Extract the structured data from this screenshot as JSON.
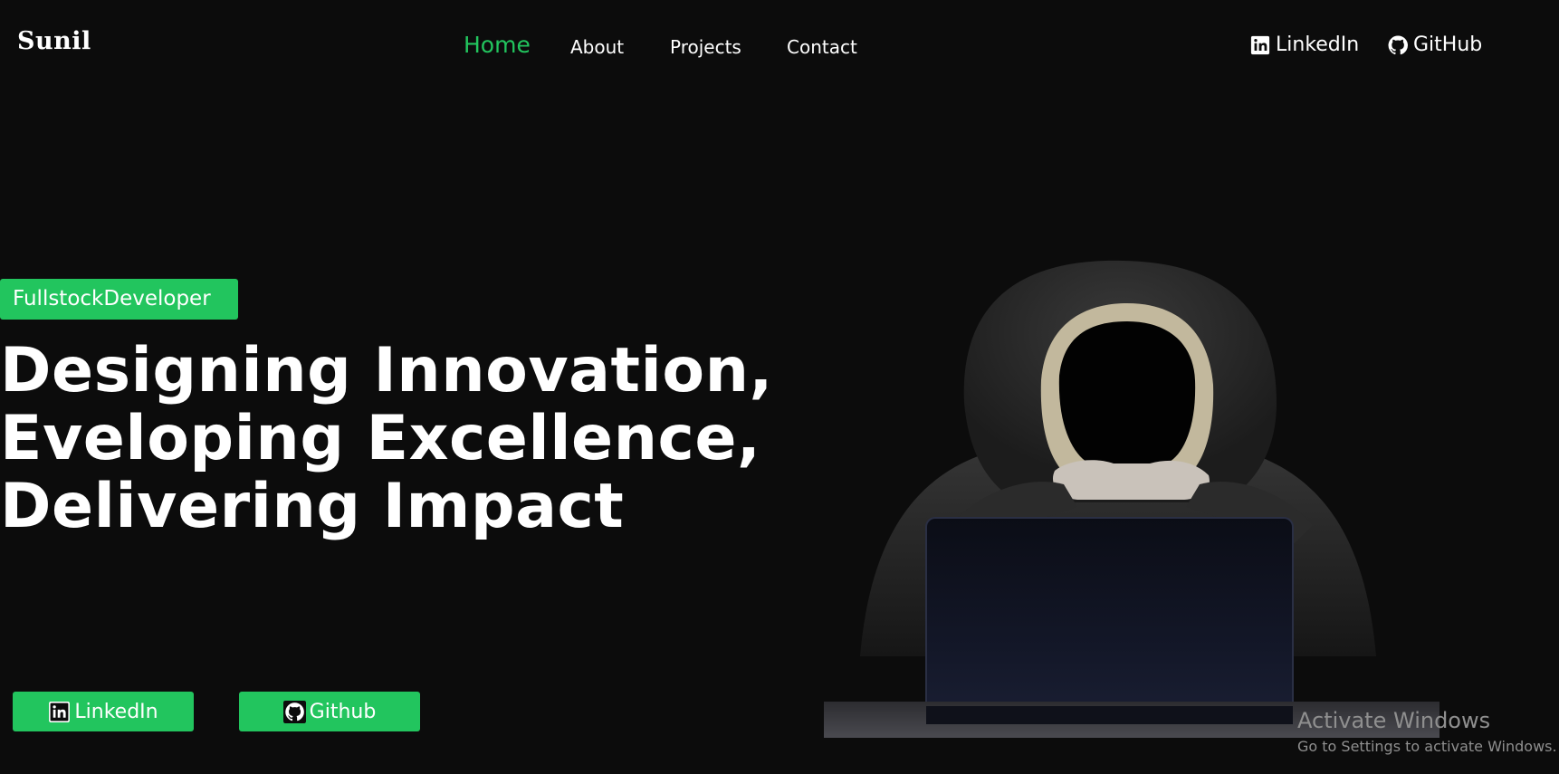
{
  "brand": {
    "name": "Sunil"
  },
  "nav": {
    "items": [
      {
        "label": "Home",
        "active": true
      },
      {
        "label": "About"
      },
      {
        "label": "Projects"
      },
      {
        "label": "Contact"
      }
    ],
    "active_color": "#22c55e"
  },
  "social": {
    "linkedin_label": "LinkedIn",
    "github_label": "GitHub",
    "linkedin_icon": "linkedin-icon",
    "github_icon": "github-icon"
  },
  "hero": {
    "badge": "FullstockDeveloper",
    "headline_lines": [
      "Designing Innovation,",
      "Eveloping Excellence,",
      "Delivering Impact"
    ],
    "buttons": {
      "linkedin_label": "LinkedIn",
      "github_label": "Github"
    },
    "accent_color": "#22c55e",
    "illustration": "hooded-hacker-with-laptop"
  },
  "watermark": {
    "title": "Activate Windows",
    "subtitle": "Go to Settings to activate Windows."
  }
}
